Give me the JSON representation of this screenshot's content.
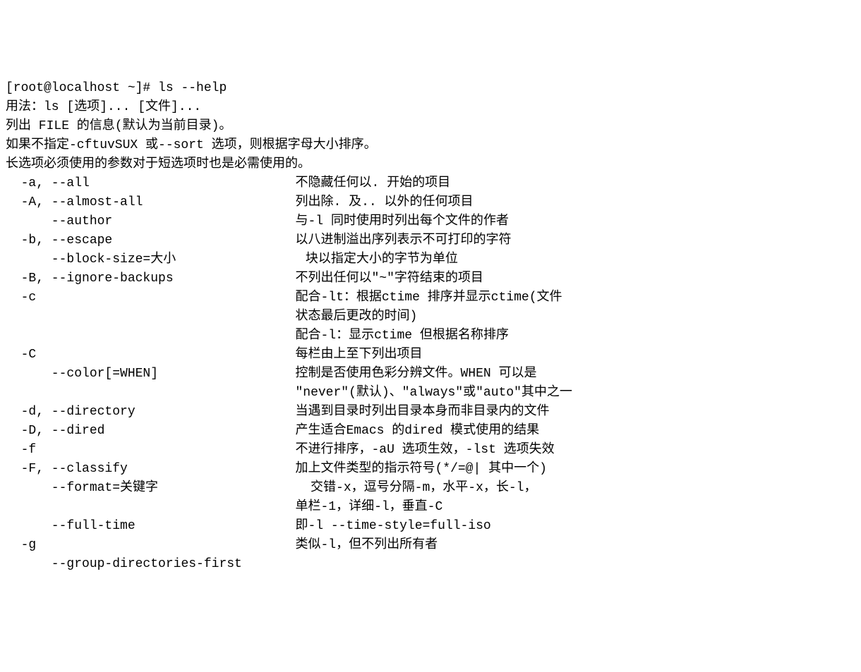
{
  "terminal": {
    "prompt": "[root@localhost ~]# ",
    "command": "ls --help",
    "usage": "用法：ls [选项]... [文件]...",
    "desc1": "列出 FILE 的信息(默认为当前目录)。",
    "desc2": "如果不指定-cftuvSUX 或--sort 选项，则根据字母大小排序。",
    "blank1": "",
    "desc3": "长选项必须使用的参数对于短选项时也是必需使用的。",
    "options": [
      {
        "flag": "  -a, --all",
        "desc": "不隐藏任何以. 开始的项目"
      },
      {
        "flag": "  -A, --almost-all",
        "desc": "列出除. 及.. 以外的任何项目"
      },
      {
        "flag": "      --author",
        "desc": "与-l 同时使用时列出每个文件的作者"
      },
      {
        "flag": "  -b, --escape",
        "desc": "以八进制溢出序列表示不可打印的字符"
      },
      {
        "flag": "      --block-size=大小",
        "desc": "块以指定大小的字节为单位"
      },
      {
        "flag": "  -B, --ignore-backups",
        "desc": "不列出任何以\"~\"字符结束的项目"
      },
      {
        "flag": "  -c",
        "desc": "配合-lt：根据ctime 排序并显示ctime(文件"
      },
      {
        "flag": "",
        "desc": "状态最后更改的时间)"
      },
      {
        "flag": "",
        "desc": "配合-l：显示ctime 但根据名称排序"
      },
      {
        "flag": "  -C",
        "desc": "每栏由上至下列出项目"
      },
      {
        "flag": "      --color[=WHEN]",
        "desc": "控制是否使用色彩分辨文件。WHEN 可以是"
      },
      {
        "flag": "",
        "desc": "\"never\"(默认)、\"always\"或\"auto\"其中之一"
      },
      {
        "flag": "  -d, --directory",
        "desc": "当遇到目录时列出目录本身而非目录内的文件"
      },
      {
        "flag": "  -D, --dired",
        "desc": "产生适合Emacs 的dired 模式使用的结果"
      },
      {
        "flag": "  -f",
        "desc": "不进行排序，-aU 选项生效，-lst 选项失效"
      },
      {
        "flag": "  -F, --classify",
        "desc": "加上文件类型的指示符号(*/=@| 其中一个)"
      },
      {
        "flag": "      --format=关键字",
        "desc": "交错-x，逗号分隔-m，水平-x，长-l，"
      },
      {
        "flag": "",
        "desc": "单栏-1，详细-l，垂直-C"
      },
      {
        "flag": "      --full-time",
        "desc": "即-l --time-style=full-iso"
      },
      {
        "flag": "  -g",
        "desc": "类似-l，但不列出所有者"
      },
      {
        "flag": "      --group-directories-first",
        "desc": ""
      }
    ]
  }
}
